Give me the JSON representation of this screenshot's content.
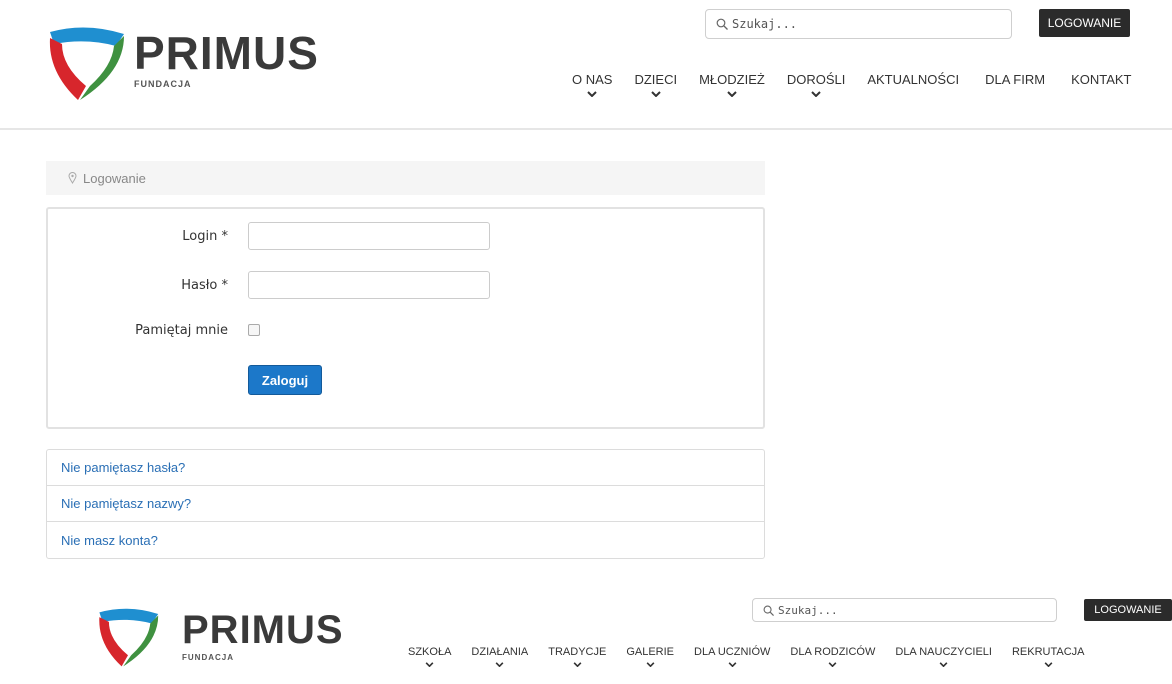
{
  "header_top": {
    "brand_name": "PRIMUS",
    "brand_sub": "FUNDACJA",
    "search_placeholder": "Szukaj...",
    "login_label": "LOGOWANIE",
    "nav": [
      "O NAS",
      "DZIECI",
      "MŁODZIEŻ",
      "DOROŚLI",
      "AKTUALNOŚCI",
      "DLA FIRM",
      "KONTAKT"
    ]
  },
  "breadcrumb": {
    "label": "Logowanie"
  },
  "form": {
    "login_label": "Login *",
    "password_label": "Hasło *",
    "remember_label": "Pamiętaj mnie",
    "submit_label": "Zaloguj",
    "login_value": "",
    "password_value": ""
  },
  "links": [
    "Nie pamiętasz hasła?",
    "Nie pamiętasz nazwy?",
    "Nie masz konta?"
  ],
  "header_bottom": {
    "brand_name": "PRIMUS",
    "brand_sub": "FUNDACJA",
    "search_placeholder": "Szukaj...",
    "login_label": "LOGOWANIE",
    "nav": [
      "SZKOŁA",
      "DZIAŁANIA",
      "TRADYCJE",
      "GALERIE",
      "DLA UCZNIÓW",
      "DLA RODZICÓW",
      "DLA NAUCZYCIELI",
      "REKRUTACJA"
    ]
  },
  "colors": {
    "logo_blue": "#1f8fd0",
    "logo_red": "#d7262c",
    "logo_green": "#3f9140",
    "link": "#2a6fb5",
    "button": "#1c78c9"
  }
}
